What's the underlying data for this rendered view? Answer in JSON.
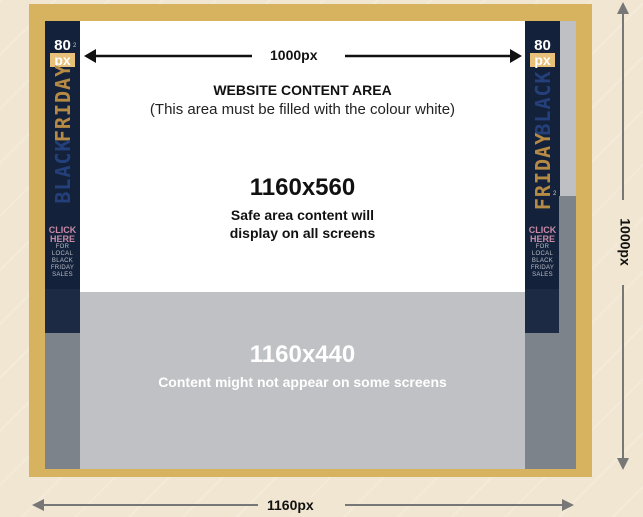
{
  "width_arrow": {
    "label": "1000px"
  },
  "outer_width_arrow": {
    "label": "1160px"
  },
  "height_arrow": {
    "label": "1000px"
  },
  "content_area": {
    "title": "WEBSITE CONTENT AREA",
    "subtitle": "(This area must be filled with the colour white)"
  },
  "safe_area": {
    "dimensions": "1160x560",
    "line1": "Safe area content will",
    "line2": "display on all screens"
  },
  "unsafe_area": {
    "dimensions": "1160x440",
    "note": "Content might not appear on some screens"
  },
  "side_banner": {
    "size_value": "80",
    "size_unit": "px",
    "word1": "BLACK",
    "word2": "FRIDAY",
    "small_mark": "2",
    "cta": [
      "CLICK",
      "HERE"
    ],
    "small_text": [
      "FOR",
      "LOCAL",
      "BLACK",
      "FRIDAY",
      "SALES"
    ]
  },
  "colors": {
    "frame": "#d7b25f",
    "content_white": "#ffffff",
    "unsafe_grey": "#c0c1c5",
    "banner_navy": "#14213a",
    "background": "#f1e6d1"
  }
}
